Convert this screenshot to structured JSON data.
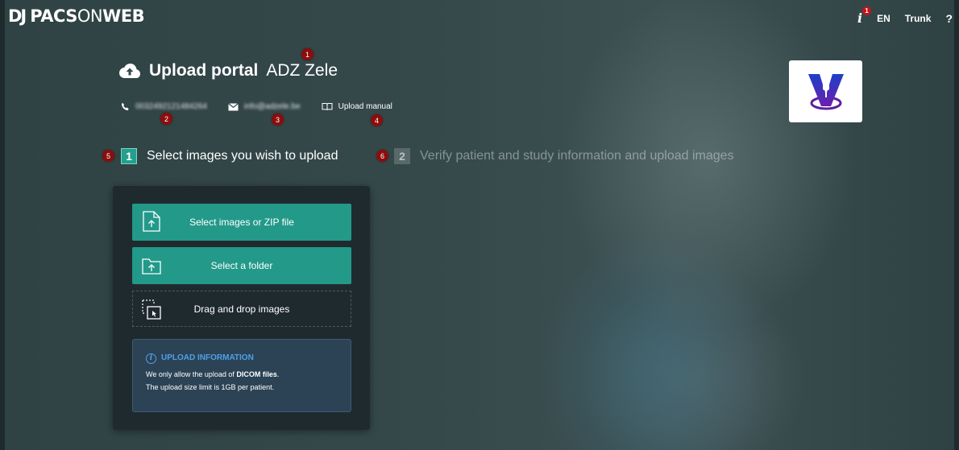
{
  "brand": {
    "mark": "DJ",
    "bold": "PACS",
    "thin": "ON",
    "bold2": "WEB"
  },
  "topnav": {
    "info_badge": "1",
    "language": "EN",
    "tenant": "Trunk",
    "help": "?"
  },
  "header": {
    "title_bold": "Upload portal",
    "title_rest": "ADZ Zele",
    "phone": "0032492121484264",
    "email": "info@adzele.be",
    "manual": "Upload manual"
  },
  "badges": [
    "1",
    "2",
    "3",
    "4",
    "5",
    "6"
  ],
  "steps": [
    {
      "number": "1",
      "label": "Select images you wish to upload"
    },
    {
      "number": "2",
      "label": "Verify patient and study information and upload images"
    }
  ],
  "panel": {
    "select_files": "Select images or ZIP file",
    "select_folder": "Select a folder",
    "drag_drop": "Drag and drop images",
    "info_title": "UPLOAD INFORMATION",
    "info_line1_pre": "We only allow the upload of ",
    "info_line1_bold": "DICOM files",
    "info_line1_post": ".",
    "info_line2": "The upload size limit is 1GB per patient."
  },
  "colors": {
    "accent": "#23998a",
    "badge": "#8c0d0d",
    "info": "#4fa0e8",
    "panel": "#1f2a2e"
  }
}
